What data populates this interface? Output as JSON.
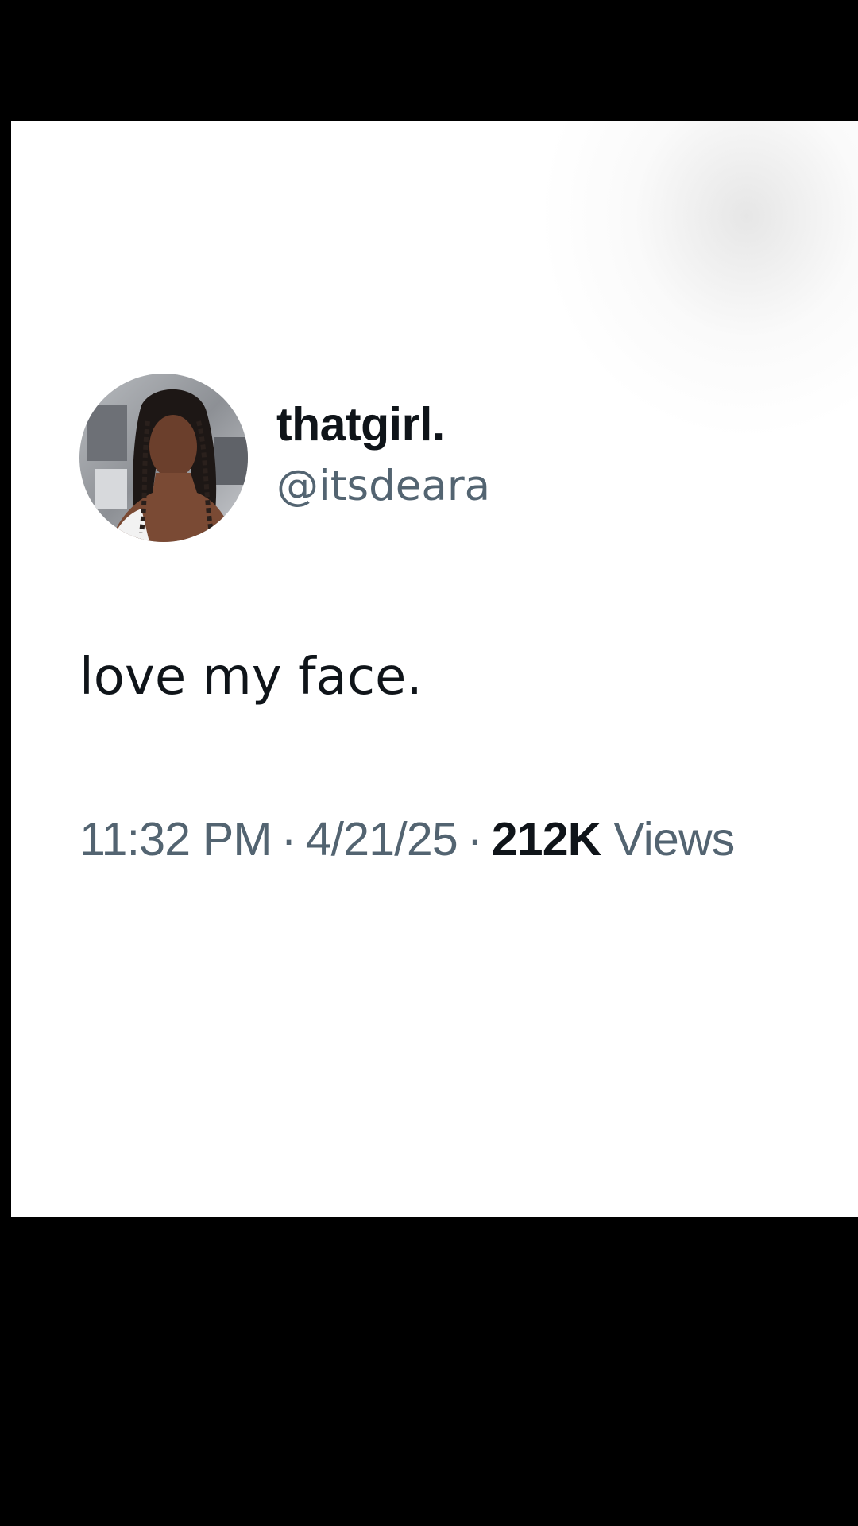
{
  "tweet": {
    "display_name": "thatgirl.",
    "handle": "@itsdeara",
    "text": "love my face.",
    "time": "11:32 PM",
    "separator": "·",
    "date": "4/21/25",
    "views_count": "212K",
    "views_label": "Views"
  },
  "colors": {
    "background": "#000000",
    "card": "#ffffff",
    "primary_text": "#0f1419",
    "secondary_text": "#536471"
  },
  "icons": {
    "avatar": "profile-photo"
  }
}
